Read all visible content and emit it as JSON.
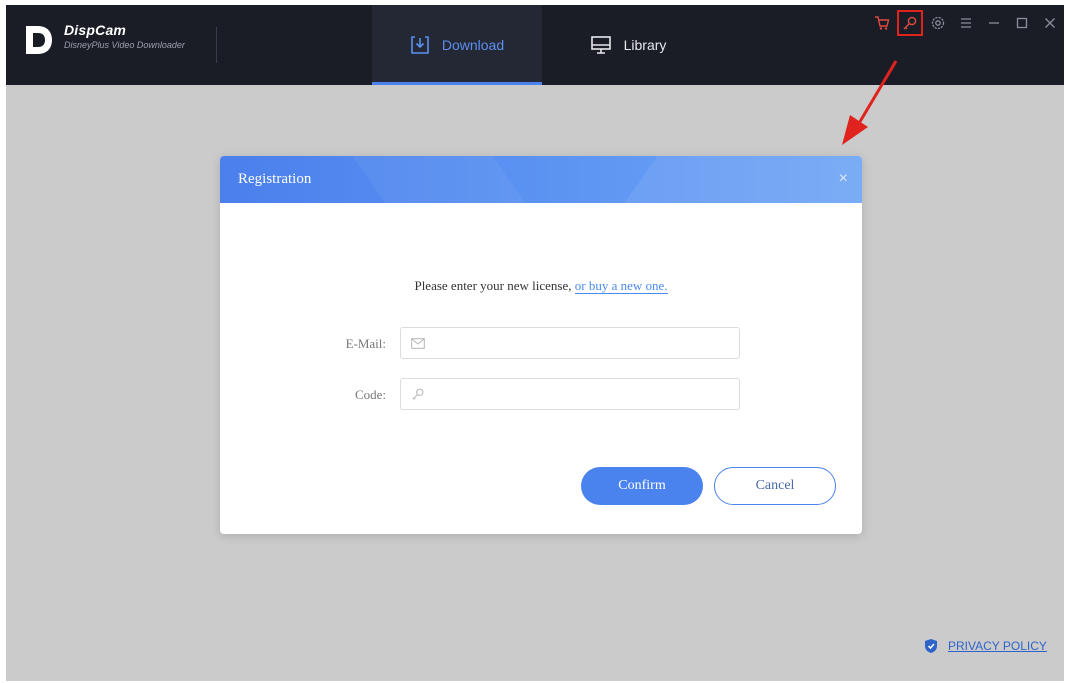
{
  "app": {
    "name": "DispCam",
    "subtitle": "DisneyPlus Video Downloader"
  },
  "tabs": [
    {
      "label": "Download",
      "active": true,
      "icon": "download-icon"
    },
    {
      "label": "Library",
      "active": false,
      "icon": "monitor-icon"
    }
  ],
  "toolbar": {
    "icons": [
      "cart-icon",
      "key-icon",
      "gear-icon",
      "menu-icon",
      "minimize-icon",
      "maximize-icon",
      "close-icon"
    ],
    "highlighted": "key-icon"
  },
  "dialog": {
    "title": "Registration",
    "close_glyph": "×",
    "prompt_text": "Please enter your new license, ",
    "prompt_link": "or buy a new one.",
    "email_label": "E-Mail:",
    "email_value": "",
    "code_label": "Code:",
    "code_value": "",
    "confirm_label": "Confirm",
    "cancel_label": "Cancel"
  },
  "footer": {
    "privacy_label": "PRIVACY POLICY"
  },
  "colors": {
    "accent": "#4b83ee",
    "titlebar": "#1b1d26",
    "highlight": "#e0231e",
    "background": "#cbcbcb"
  }
}
